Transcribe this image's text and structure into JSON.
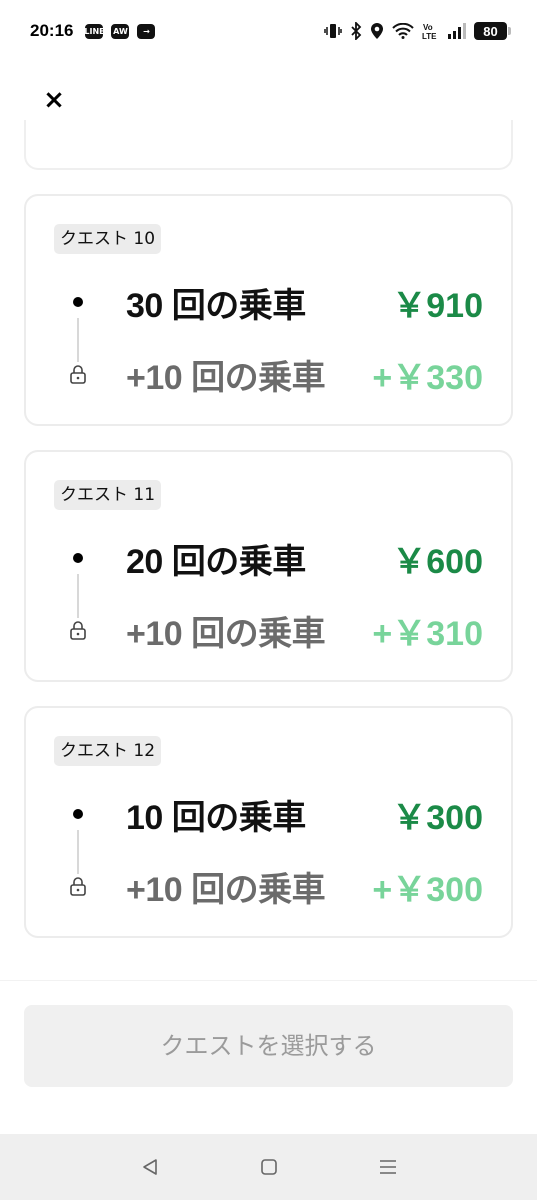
{
  "status_bar": {
    "time": "20:16",
    "apps": [
      "LINE",
      "AW",
      "→"
    ],
    "battery": "80"
  },
  "close_icon": "×",
  "quests": [
    {
      "tag": "クエスト 10",
      "rides": "30 回の乗車",
      "amount": "￥910",
      "bonus_rides": "+10 回の乗車",
      "bonus_amount": "+￥330"
    },
    {
      "tag": "クエスト 11",
      "rides": "20 回の乗車",
      "amount": "￥600",
      "bonus_rides": "+10 回の乗車",
      "bonus_amount": "+￥310"
    },
    {
      "tag": "クエスト 12",
      "rides": "10 回の乗車",
      "amount": "￥300",
      "bonus_rides": "+10 回の乗車",
      "bonus_amount": "+￥300"
    }
  ],
  "select_button": "クエストを選択する",
  "colors": {
    "amount": "#1b8a47",
    "bonus_amount": "#78d49a"
  }
}
